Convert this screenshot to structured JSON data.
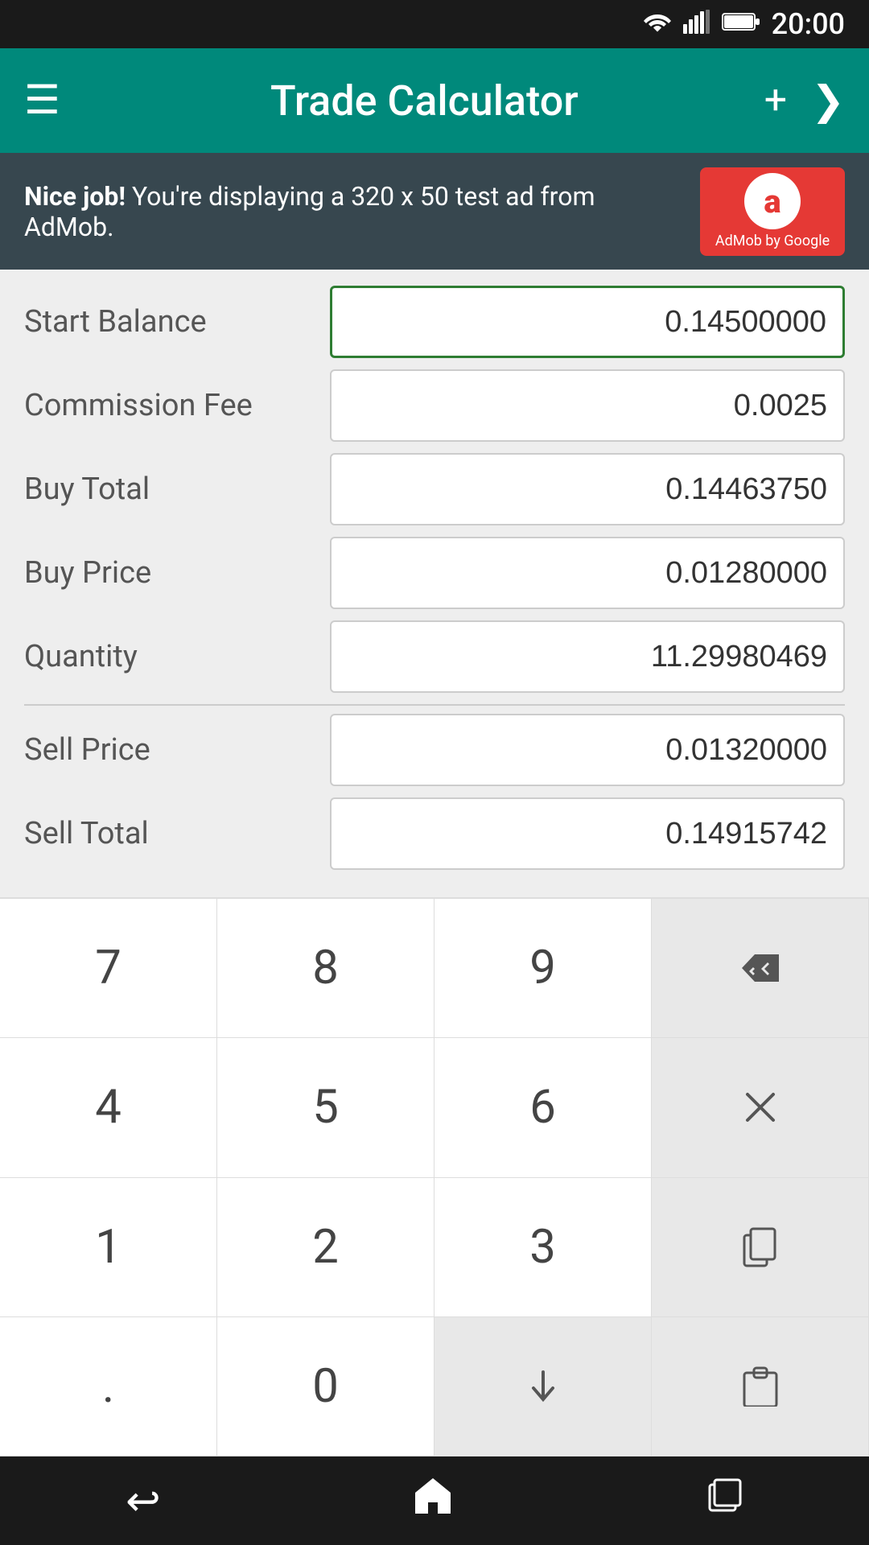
{
  "status_bar": {
    "time": "20:00",
    "wifi": "📶",
    "signal": "📶",
    "battery": "🔋"
  },
  "app_bar": {
    "title": "Trade Calculator",
    "menu_icon": "☰",
    "add_icon": "+",
    "next_icon": "❯"
  },
  "ad_banner": {
    "text_bold": "Nice job!",
    "text_normal": " You're displaying a 320 x 50 test ad from AdMob.",
    "logo_letter": "a",
    "logo_subtext": "AdMob by Google"
  },
  "form": {
    "fields": [
      {
        "label": "Start Balance",
        "value": "0.14500000",
        "active": true,
        "id": "start-balance"
      },
      {
        "label": "Commission Fee",
        "value": "0.0025",
        "active": false,
        "id": "commission-fee"
      },
      {
        "label": "Buy Total",
        "value": "0.14463750",
        "active": false,
        "id": "buy-total"
      },
      {
        "label": "Buy Price",
        "value": "0.01280000",
        "active": false,
        "id": "buy-price"
      },
      {
        "label": "Quantity",
        "value": "11.29980469",
        "active": false,
        "id": "quantity"
      }
    ],
    "fields2": [
      {
        "label": "Sell Price",
        "value": "0.01320000",
        "active": false,
        "id": "sell-price"
      },
      {
        "label": "Sell Total",
        "value": "0.14915742",
        "active": false,
        "id": "sell-total"
      }
    ]
  },
  "numpad": {
    "keys": [
      {
        "label": "7",
        "type": "digit"
      },
      {
        "label": "8",
        "type": "digit"
      },
      {
        "label": "9",
        "type": "digit"
      },
      {
        "label": "⌫",
        "type": "action"
      },
      {
        "label": "4",
        "type": "digit"
      },
      {
        "label": "5",
        "type": "digit"
      },
      {
        "label": "6",
        "type": "digit"
      },
      {
        "label": "×",
        "type": "action"
      },
      {
        "label": "1",
        "type": "digit"
      },
      {
        "label": "2",
        "type": "digit"
      },
      {
        "label": "3",
        "type": "digit"
      },
      {
        "label": "⧉",
        "type": "action"
      },
      {
        "label": ".",
        "type": "digit"
      },
      {
        "label": "0",
        "type": "digit"
      },
      {
        "label": "↓",
        "type": "action"
      },
      {
        "label": "📋",
        "type": "action"
      }
    ]
  },
  "nav_bar": {
    "back_icon": "↩",
    "home_icon": "⌂",
    "recent_icon": "◻"
  }
}
